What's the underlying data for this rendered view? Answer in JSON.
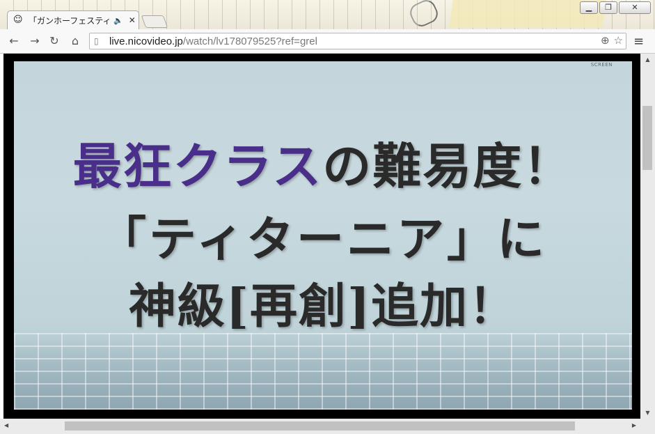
{
  "window": {
    "minimize_label": "▁",
    "maximize_label": "❐",
    "close_label": "✕"
  },
  "tab": {
    "title": "「ガンホーフェスティ",
    "favicon": "nico-face-icon",
    "audio_icon": "🔈",
    "close_icon": "✕"
  },
  "toolbar": {
    "back": "←",
    "forward": "→",
    "reload": "↻",
    "home": "⌂",
    "url_host": "live.nicovideo.jp",
    "url_rest": "/watch/lv178079525?ref=grel",
    "zoom_icon": "⊕",
    "star_icon": "☆",
    "menu_icon": "≡"
  },
  "video": {
    "corner_tag": "SCREEN",
    "line1_highlight": "最狂クラス",
    "line1_rest": "の難易度！",
    "line2": "「ティターニア」に",
    "line3": "神級[再創]追加！"
  },
  "scrollbars": {
    "up": "▲",
    "down": "▼",
    "left": "◀",
    "right": "▶"
  }
}
